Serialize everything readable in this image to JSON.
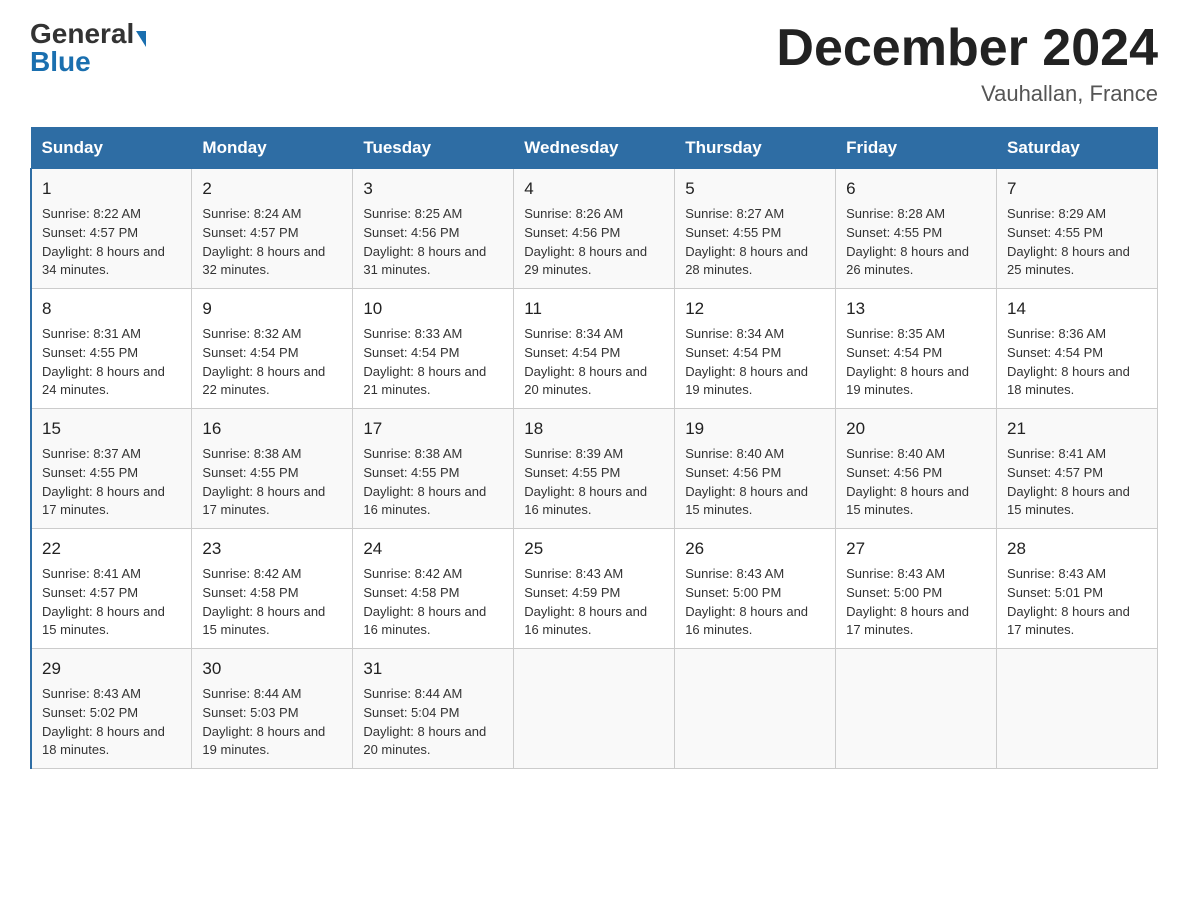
{
  "header": {
    "logo_general": "General",
    "logo_blue": "Blue",
    "month_title": "December 2024",
    "location": "Vauhallan, France"
  },
  "days_of_week": [
    "Sunday",
    "Monday",
    "Tuesday",
    "Wednesday",
    "Thursday",
    "Friday",
    "Saturday"
  ],
  "weeks": [
    [
      {
        "day": "1",
        "sunrise": "8:22 AM",
        "sunset": "4:57 PM",
        "daylight": "8 hours and 34 minutes."
      },
      {
        "day": "2",
        "sunrise": "8:24 AM",
        "sunset": "4:57 PM",
        "daylight": "8 hours and 32 minutes."
      },
      {
        "day": "3",
        "sunrise": "8:25 AM",
        "sunset": "4:56 PM",
        "daylight": "8 hours and 31 minutes."
      },
      {
        "day": "4",
        "sunrise": "8:26 AM",
        "sunset": "4:56 PM",
        "daylight": "8 hours and 29 minutes."
      },
      {
        "day": "5",
        "sunrise": "8:27 AM",
        "sunset": "4:55 PM",
        "daylight": "8 hours and 28 minutes."
      },
      {
        "day": "6",
        "sunrise": "8:28 AM",
        "sunset": "4:55 PM",
        "daylight": "8 hours and 26 minutes."
      },
      {
        "day": "7",
        "sunrise": "8:29 AM",
        "sunset": "4:55 PM",
        "daylight": "8 hours and 25 minutes."
      }
    ],
    [
      {
        "day": "8",
        "sunrise": "8:31 AM",
        "sunset": "4:55 PM",
        "daylight": "8 hours and 24 minutes."
      },
      {
        "day": "9",
        "sunrise": "8:32 AM",
        "sunset": "4:54 PM",
        "daylight": "8 hours and 22 minutes."
      },
      {
        "day": "10",
        "sunrise": "8:33 AM",
        "sunset": "4:54 PM",
        "daylight": "8 hours and 21 minutes."
      },
      {
        "day": "11",
        "sunrise": "8:34 AM",
        "sunset": "4:54 PM",
        "daylight": "8 hours and 20 minutes."
      },
      {
        "day": "12",
        "sunrise": "8:34 AM",
        "sunset": "4:54 PM",
        "daylight": "8 hours and 19 minutes."
      },
      {
        "day": "13",
        "sunrise": "8:35 AM",
        "sunset": "4:54 PM",
        "daylight": "8 hours and 19 minutes."
      },
      {
        "day": "14",
        "sunrise": "8:36 AM",
        "sunset": "4:54 PM",
        "daylight": "8 hours and 18 minutes."
      }
    ],
    [
      {
        "day": "15",
        "sunrise": "8:37 AM",
        "sunset": "4:55 PM",
        "daylight": "8 hours and 17 minutes."
      },
      {
        "day": "16",
        "sunrise": "8:38 AM",
        "sunset": "4:55 PM",
        "daylight": "8 hours and 17 minutes."
      },
      {
        "day": "17",
        "sunrise": "8:38 AM",
        "sunset": "4:55 PM",
        "daylight": "8 hours and 16 minutes."
      },
      {
        "day": "18",
        "sunrise": "8:39 AM",
        "sunset": "4:55 PM",
        "daylight": "8 hours and 16 minutes."
      },
      {
        "day": "19",
        "sunrise": "8:40 AM",
        "sunset": "4:56 PM",
        "daylight": "8 hours and 15 minutes."
      },
      {
        "day": "20",
        "sunrise": "8:40 AM",
        "sunset": "4:56 PM",
        "daylight": "8 hours and 15 minutes."
      },
      {
        "day": "21",
        "sunrise": "8:41 AM",
        "sunset": "4:57 PM",
        "daylight": "8 hours and 15 minutes."
      }
    ],
    [
      {
        "day": "22",
        "sunrise": "8:41 AM",
        "sunset": "4:57 PM",
        "daylight": "8 hours and 15 minutes."
      },
      {
        "day": "23",
        "sunrise": "8:42 AM",
        "sunset": "4:58 PM",
        "daylight": "8 hours and 15 minutes."
      },
      {
        "day": "24",
        "sunrise": "8:42 AM",
        "sunset": "4:58 PM",
        "daylight": "8 hours and 16 minutes."
      },
      {
        "day": "25",
        "sunrise": "8:43 AM",
        "sunset": "4:59 PM",
        "daylight": "8 hours and 16 minutes."
      },
      {
        "day": "26",
        "sunrise": "8:43 AM",
        "sunset": "5:00 PM",
        "daylight": "8 hours and 16 minutes."
      },
      {
        "day": "27",
        "sunrise": "8:43 AM",
        "sunset": "5:00 PM",
        "daylight": "8 hours and 17 minutes."
      },
      {
        "day": "28",
        "sunrise": "8:43 AM",
        "sunset": "5:01 PM",
        "daylight": "8 hours and 17 minutes."
      }
    ],
    [
      {
        "day": "29",
        "sunrise": "8:43 AM",
        "sunset": "5:02 PM",
        "daylight": "8 hours and 18 minutes."
      },
      {
        "day": "30",
        "sunrise": "8:44 AM",
        "sunset": "5:03 PM",
        "daylight": "8 hours and 19 minutes."
      },
      {
        "day": "31",
        "sunrise": "8:44 AM",
        "sunset": "5:04 PM",
        "daylight": "8 hours and 20 minutes."
      },
      null,
      null,
      null,
      null
    ]
  ],
  "labels": {
    "sunrise": "Sunrise:",
    "sunset": "Sunset:",
    "daylight": "Daylight:"
  }
}
